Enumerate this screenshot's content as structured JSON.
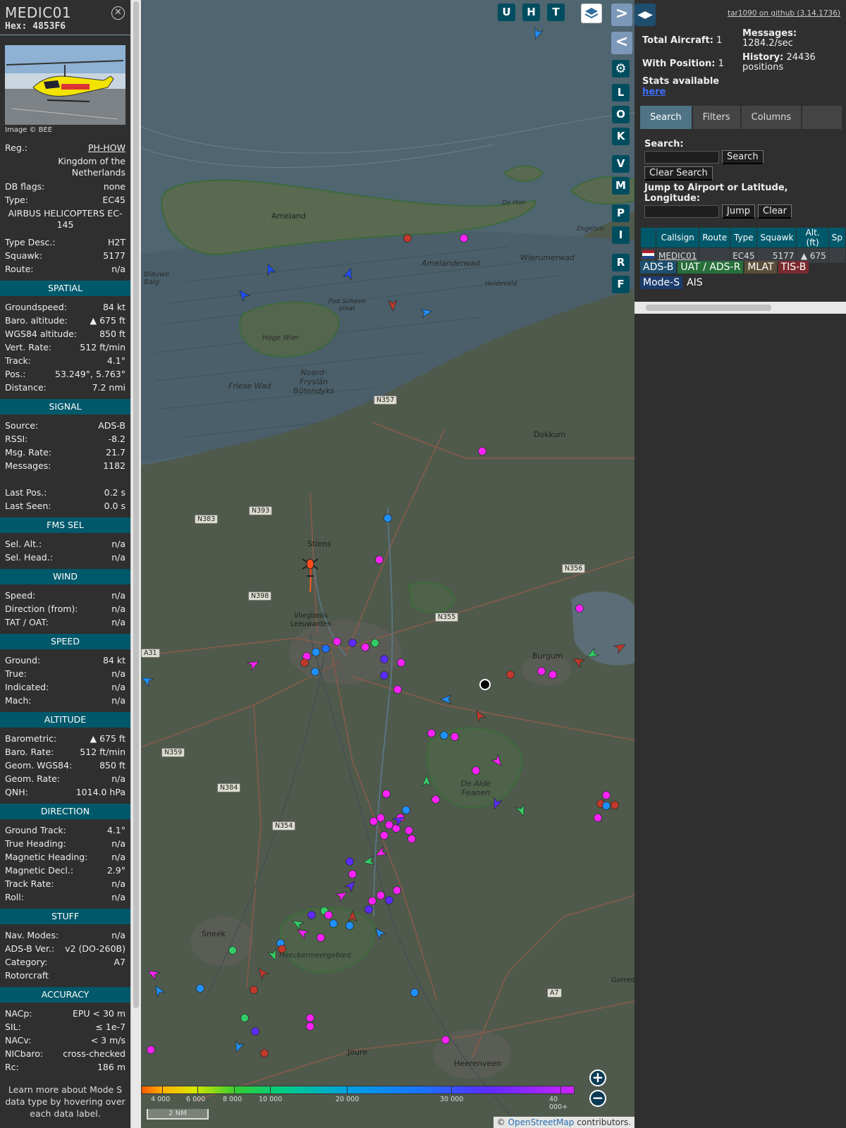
{
  "selected": {
    "callsign": "MEDIC01",
    "hex_label": "Hex:",
    "hex": "4853F6",
    "image_credit": "Image © BEE",
    "summary": [
      {
        "k": "Reg.:",
        "v": "PH-HOW"
      },
      {
        "k": "",
        "v": "Kingdom of the Netherlands"
      },
      {
        "k": "DB flags:",
        "v": "none"
      },
      {
        "k": "Type:",
        "v": "EC45"
      }
    ],
    "type_full": "AIRBUS HELICOPTERS EC-145",
    "summary2": [
      {
        "k": "Type Desc.:",
        "v": "H2T"
      },
      {
        "k": "Squawk:",
        "v": "5177"
      },
      {
        "k": "Route:",
        "v": "n/a"
      }
    ],
    "sections": [
      {
        "title": "SPATIAL",
        "rows": [
          {
            "k": "Groundspeed:",
            "v": "84 kt"
          },
          {
            "k": "Baro. altitude:",
            "v": "▲ 675 ft"
          },
          {
            "k": "WGS84 altitude:",
            "v": "850 ft"
          },
          {
            "k": "Vert. Rate:",
            "v": "512 ft/min"
          },
          {
            "k": "Track:",
            "v": "4.1°"
          },
          {
            "k": "Pos.:",
            "v": "53.249°, 5.763°"
          },
          {
            "k": "Distance:",
            "v": "7.2 nmi"
          }
        ]
      },
      {
        "title": "SIGNAL",
        "rows": [
          {
            "k": "Source:",
            "v": "ADS-B"
          },
          {
            "k": "RSSI:",
            "v": "-8.2"
          },
          {
            "k": "Msg. Rate:",
            "v": "21.7"
          },
          {
            "k": "Messages:",
            "v": "1182"
          },
          {
            "k": "",
            "v": ""
          },
          {
            "k": "Last Pos.:",
            "v": "0.2 s"
          },
          {
            "k": "Last Seen:",
            "v": "0.0 s"
          }
        ]
      },
      {
        "title": "FMS SEL",
        "rows": [
          {
            "k": "Sel. Alt.:",
            "v": "n/a"
          },
          {
            "k": "Sel. Head.:",
            "v": "n/a"
          }
        ]
      },
      {
        "title": "WIND",
        "rows": [
          {
            "k": "Speed:",
            "v": "n/a"
          },
          {
            "k": "Direction (from):",
            "v": "n/a"
          },
          {
            "k": "TAT / OAT:",
            "v": "n/a"
          }
        ]
      },
      {
        "title": "SPEED",
        "rows": [
          {
            "k": "Ground:",
            "v": "84 kt"
          },
          {
            "k": "True:",
            "v": "n/a"
          },
          {
            "k": "Indicated:",
            "v": "n/a"
          },
          {
            "k": "Mach:",
            "v": "n/a"
          }
        ]
      },
      {
        "title": "ALTITUDE",
        "rows": [
          {
            "k": "Barometric:",
            "v": "▲ 675 ft"
          },
          {
            "k": "Baro. Rate:",
            "v": "512 ft/min"
          },
          {
            "k": "Geom. WGS84:",
            "v": "850 ft"
          },
          {
            "k": "Geom. Rate:",
            "v": "n/a"
          },
          {
            "k": "QNH:",
            "v": "1014.0 hPa"
          }
        ]
      },
      {
        "title": "DIRECTION",
        "rows": [
          {
            "k": "Ground Track:",
            "v": "4.1°"
          },
          {
            "k": "True Heading:",
            "v": "n/a"
          },
          {
            "k": "Magnetic Heading:",
            "v": "n/a"
          },
          {
            "k": "Magnetic Decl.:",
            "v": "2.9°"
          },
          {
            "k": "Track Rate:",
            "v": "n/a"
          },
          {
            "k": "Roll:",
            "v": "n/a"
          }
        ]
      },
      {
        "title": "STUFF",
        "rows": [
          {
            "k": "Nav. Modes:",
            "v": "n/a"
          },
          {
            "k": "ADS-B Ver.:",
            "v": "v2 (DO-260B)"
          },
          {
            "k": "Category:",
            "v": "A7"
          },
          {
            "k": "Rotorcraft",
            "v": ""
          }
        ]
      },
      {
        "title": "ACCURACY",
        "rows": [
          {
            "k": "NACp:",
            "v": "EPU < 30 m"
          },
          {
            "k": "SIL:",
            "v": "≤ 1e-7"
          },
          {
            "k": "NACv:",
            "v": "< 3 m/s"
          },
          {
            "k": "NICbaro:",
            "v": "cross-checked"
          },
          {
            "k": "Rc:",
            "v": "186 m"
          }
        ]
      }
    ],
    "footer": "Learn more about Mode S data type by hovering over each data label."
  },
  "map": {
    "buttons_top": [
      "U",
      "H",
      "T"
    ],
    "buttons_side": [
      "L",
      "O",
      "K",
      "V",
      "M",
      "P",
      "I",
      "R",
      "F"
    ],
    "places": [
      "Ameland",
      "Amelanderwad",
      "Wierumerwad",
      "Heideveld",
      "Piet Scheve plaat",
      "Hoge Wier",
      "Friese Wad",
      "Noard-Fryslân Bûtendyks",
      "Blauwe Balg",
      "De Hon",
      "Engelsm",
      "Dokkum",
      "Stiens",
      "Vliegbasis Leeuwarden",
      "Burgum",
      "De Alde Feanen",
      "Sneek",
      "Heeckermeergebied",
      "Joure",
      "Heerenveen",
      "Gorred"
    ],
    "roads": [
      "N357",
      "N393",
      "N383",
      "N398",
      "N356",
      "N355",
      "N359",
      "N384",
      "N354",
      "A31",
      "A7"
    ],
    "legend_ticks": [
      "4 000",
      "6 000",
      "8 000",
      "10 000",
      "20 000",
      "30 000",
      "40 000+"
    ],
    "scale": "2 NM",
    "attribution_prefix": "© ",
    "attribution_link": "OpenStreetMap",
    "attribution_suffix": " contributors.",
    "zoom_in": "+",
    "zoom_out": "−"
  },
  "side": {
    "github": "tar1090 on github (3.14.1736)",
    "total_aircraft_label": "Total Aircraft:",
    "total_aircraft": "1",
    "with_position_label": "With Position:",
    "with_position": "1",
    "messages_label": "Messages:",
    "messages": "1284.2/sec",
    "history_label": "History:",
    "history": "24436 positions",
    "stats_label": "Stats available",
    "stats_link": "here",
    "tabs": [
      "Search",
      "Filters",
      "Columns"
    ],
    "search_label": "Search:",
    "search_button": "Search",
    "clear_search_button": "Clear Search",
    "jump_label": "Jump to Airport or Latitude, Longitude:",
    "jump_button": "Jump",
    "clear_button": "Clear",
    "table_headers": [
      "",
      "Callsign",
      "Route",
      "Type",
      "Squawk",
      "Alt. (ft)",
      "Sp"
    ],
    "table_row": {
      "callsign": "MEDIC01",
      "route": "",
      "type": "EC45",
      "squawk": "5177",
      "alt": "▲ 675"
    },
    "sources": [
      {
        "label": "ADS-B",
        "color": "#1d4f6e"
      },
      {
        "label": "UAT / ADS-R",
        "color": "#276f3b"
      },
      {
        "label": "MLAT",
        "color": "#5b4e38"
      },
      {
        "label": "TIS-B",
        "color": "#7a2a2e"
      },
      {
        "label": "Mode-S",
        "color": "#1d3c6e"
      },
      {
        "label": "AIS",
        "color": "#2f2f2f"
      }
    ]
  }
}
